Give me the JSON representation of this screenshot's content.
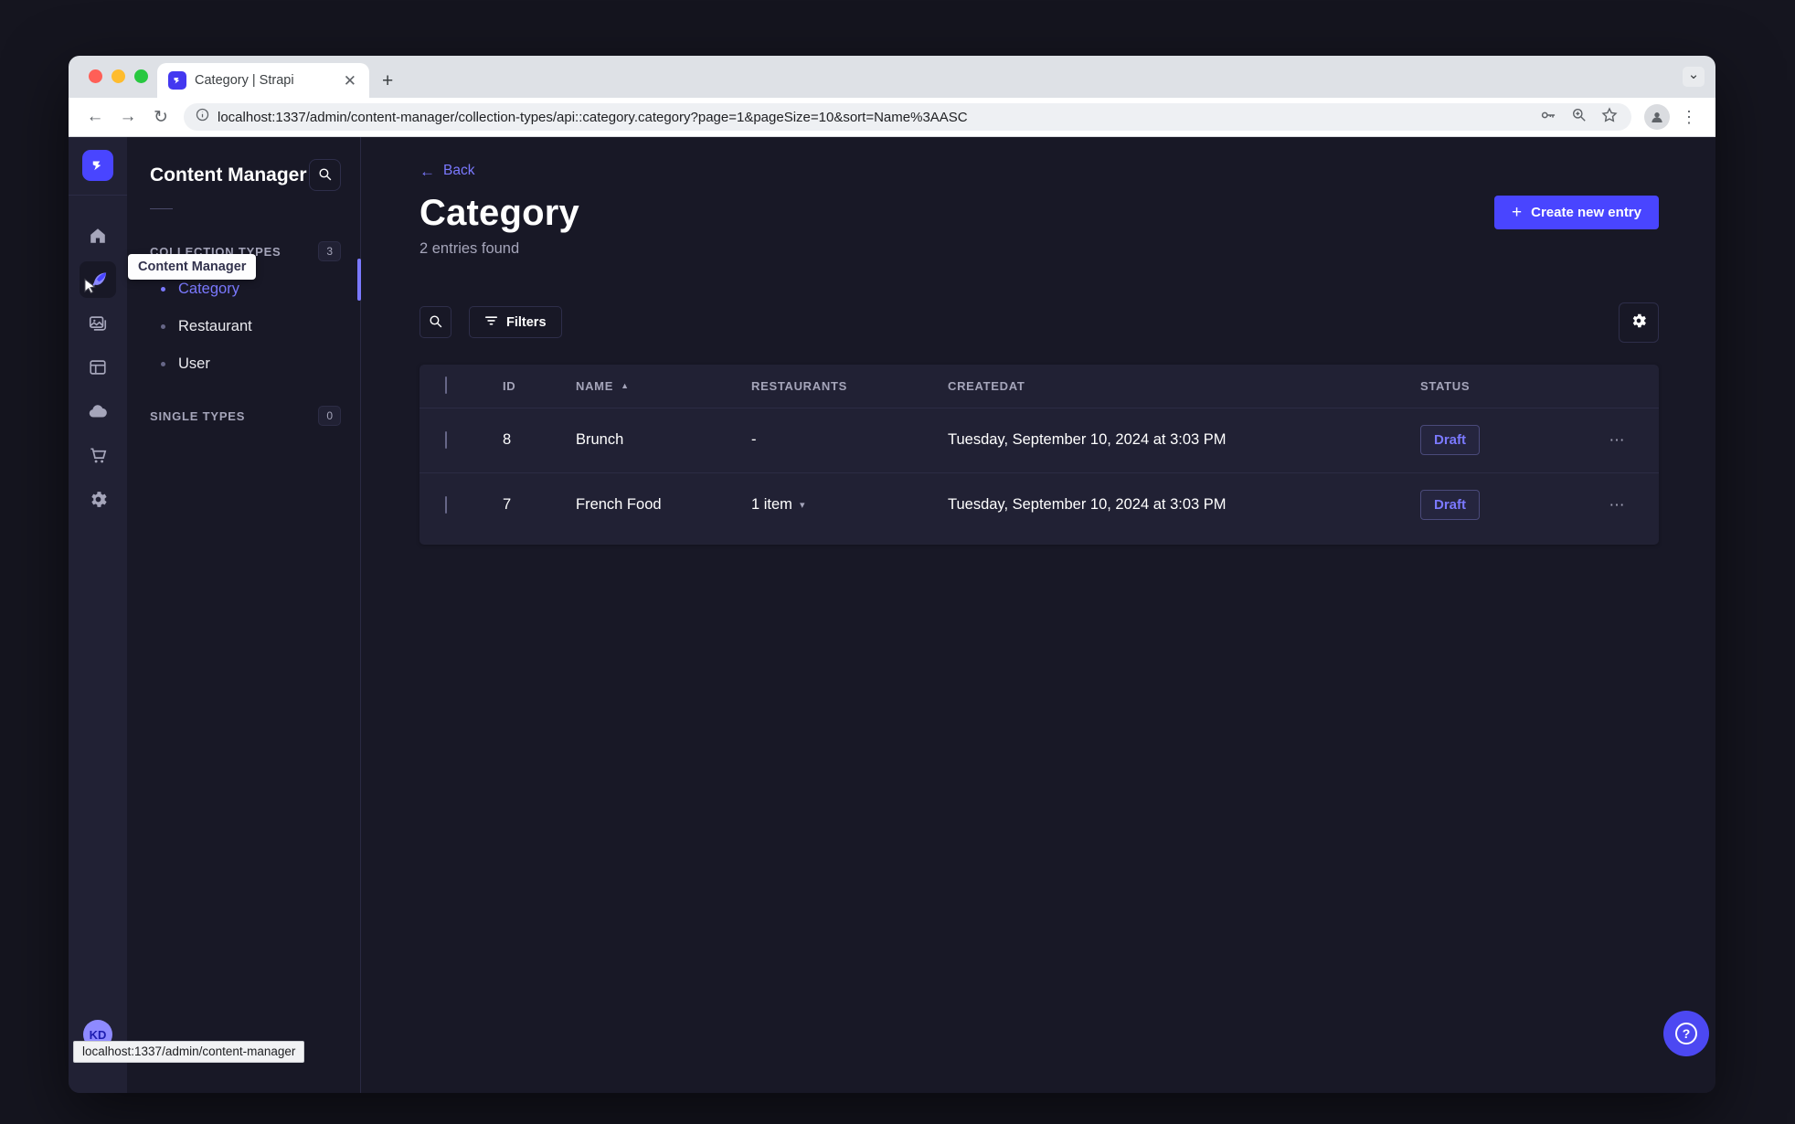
{
  "browser": {
    "tab_title": "Category | Strapi",
    "url": "localhost:1337/admin/content-manager/collection-types/api::category.category?page=1&pageSize=10&sort=Name%3AASC",
    "status_tooltip": "localhost:1337/admin/content-manager"
  },
  "mainnav": {
    "icons": [
      "home",
      "content-manager",
      "media-library",
      "content-type-builder",
      "cloud",
      "marketplace",
      "settings"
    ],
    "tooltip": "Content Manager",
    "avatar_initials": "KD"
  },
  "subnav": {
    "title": "Content Manager",
    "sections": [
      {
        "label": "COLLECTION TYPES",
        "badge": "3"
      },
      {
        "label": "SINGLE TYPES",
        "badge": "0"
      }
    ],
    "items": [
      {
        "label": "Category",
        "active": true
      },
      {
        "label": "Restaurant",
        "active": false
      },
      {
        "label": "User",
        "active": false
      }
    ]
  },
  "main": {
    "back_label": "Back",
    "title": "Category",
    "subtitle": "2 entries found",
    "create_button": "Create new entry",
    "filters_button": "Filters",
    "table": {
      "headers": {
        "id": "ID",
        "name": "NAME",
        "restaurants": "RESTAURANTS",
        "createdat": "CREATEDAT",
        "status": "STATUS"
      },
      "rows": [
        {
          "id": "8",
          "name": "Brunch",
          "restaurants": "-",
          "createdat": "Tuesday, September 10, 2024 at 3:03 PM",
          "status": "Draft"
        },
        {
          "id": "7",
          "name": "French Food",
          "restaurants": "1 item",
          "createdat": "Tuesday, September 10, 2024 at 3:03 PM",
          "status": "Draft"
        }
      ]
    }
  },
  "colors": {
    "accent": "#4945ff",
    "accent_light": "#7b79ff",
    "app_background": "#181826",
    "panel_background": "#212134",
    "status_draft": "#7b79ff"
  }
}
